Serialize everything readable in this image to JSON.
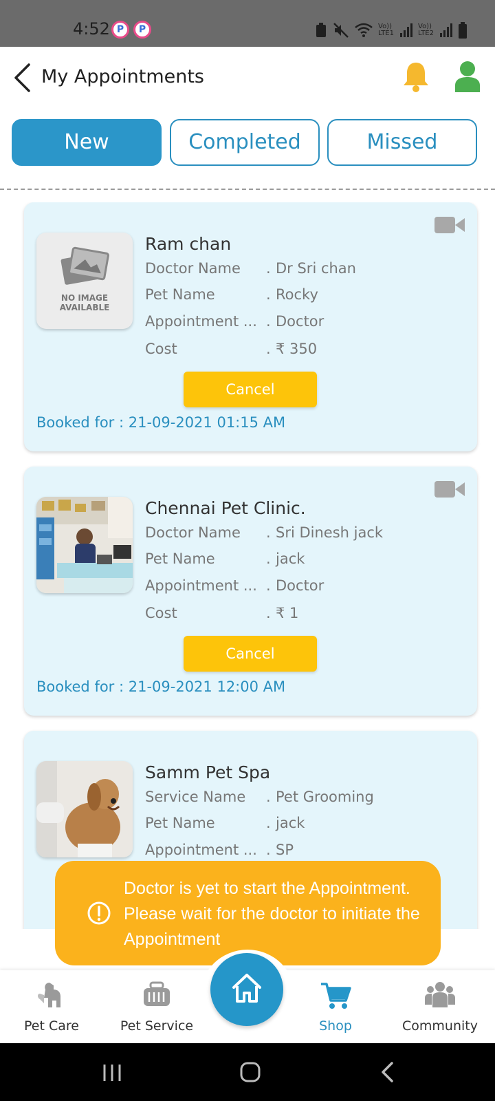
{
  "status_bar": {
    "time": "4:52",
    "app_icon_letter": "P",
    "network_labels": [
      "Vo)) LTE1",
      "Vo)) LTE2"
    ]
  },
  "header": {
    "title": "My Appointments",
    "back_icon": "chevron-left-icon",
    "bell_icon": "bell-icon",
    "profile_icon": "user-icon",
    "bell_color": "#f5b82e",
    "profile_color": "#4caf50"
  },
  "tabs": [
    {
      "label": "New",
      "active": true
    },
    {
      "label": "Completed",
      "active": false
    },
    {
      "label": "Missed",
      "active": false
    }
  ],
  "appointments": [
    {
      "title": "Ram chan",
      "no_image_text": [
        "NO IMAGE",
        "AVAILABLE"
      ],
      "rows": [
        {
          "label": "Doctor Name",
          "sep": ".",
          "value": "Dr Sri chan"
        },
        {
          "label": "Pet Name",
          "sep": ".",
          "value": "Rocky"
        },
        {
          "label": "Appointment ...",
          "sep": ".",
          "value": "Doctor"
        },
        {
          "label": "Cost",
          "sep": ".",
          "value": "₹ 350"
        }
      ],
      "cancel_label": "Cancel",
      "booked_for": "Booked for :  21-09-2021 01:15 AM"
    },
    {
      "title": "Chennai Pet Clinic.",
      "rows": [
        {
          "label": "Doctor Name",
          "sep": ".",
          "value": "Sri Dinesh jack"
        },
        {
          "label": "Pet Name",
          "sep": ".",
          "value": "jack"
        },
        {
          "label": "Appointment ...",
          "sep": ".",
          "value": "Doctor"
        },
        {
          "label": "Cost",
          "sep": ".",
          "value": "₹ 1"
        }
      ],
      "cancel_label": "Cancel",
      "booked_for": "Booked for :  21-09-2021 12:00 AM"
    },
    {
      "title": "Samm Pet Spa",
      "rows": [
        {
          "label": "Service Name",
          "sep": ".",
          "value": "Pet Grooming"
        },
        {
          "label": "Pet Name",
          "sep": ".",
          "value": "jack"
        },
        {
          "label": "Appointment ...",
          "sep": ".",
          "value": "SP"
        }
      ]
    }
  ],
  "toast": {
    "message": "Doctor is yet to start the Appointment. Please wait for the doctor to initiate the Appointment",
    "icon": "alert-circle-icon",
    "color": "#fbb21c"
  },
  "bottom_nav": {
    "items": [
      {
        "label": "Pet Care",
        "icon": "pet-care-icon"
      },
      {
        "label": "Pet Service",
        "icon": "pet-carrier-icon"
      },
      {
        "label": "Home",
        "icon": "home-icon"
      },
      {
        "label": "Shop",
        "icon": "cart-icon"
      },
      {
        "label": "Community",
        "icon": "community-icon"
      }
    ],
    "active_color": "#2596c9"
  }
}
